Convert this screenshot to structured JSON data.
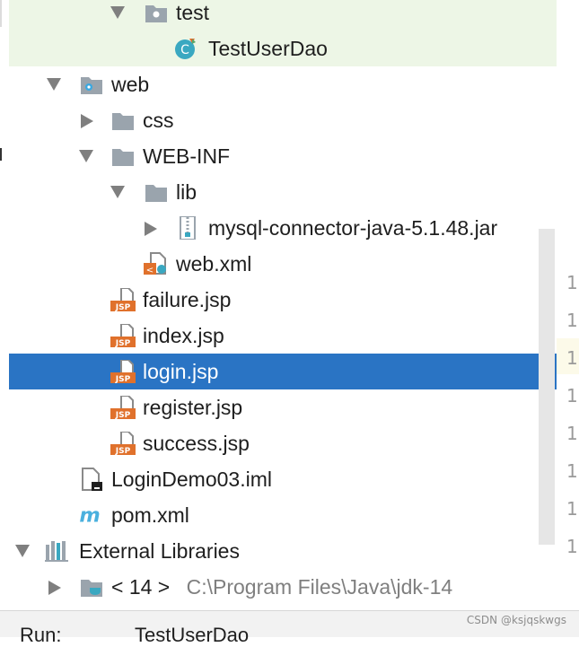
{
  "tree": {
    "items": [
      {
        "label": "test",
        "icon": "folder-icon",
        "state": "expanded"
      },
      {
        "label": "TestUserDao",
        "icon": "class-icon"
      },
      {
        "label": "web",
        "icon": "web-folder-icon",
        "state": "expanded"
      },
      {
        "label": "css",
        "icon": "folder-icon",
        "state": "collapsed"
      },
      {
        "label": "WEB-INF",
        "icon": "folder-icon",
        "state": "expanded"
      },
      {
        "label": "lib",
        "icon": "folder-icon",
        "state": "expanded"
      },
      {
        "label": "mysql-connector-java-5.1.48.jar",
        "icon": "jar-icon",
        "state": "collapsed"
      },
      {
        "label": "web.xml",
        "icon": "xml-icon"
      },
      {
        "label": "failure.jsp",
        "icon": "jsp-icon"
      },
      {
        "label": "index.jsp",
        "icon": "jsp-icon"
      },
      {
        "label": "login.jsp",
        "icon": "jsp-icon",
        "selected": true
      },
      {
        "label": "register.jsp",
        "icon": "jsp-icon"
      },
      {
        "label": "success.jsp",
        "icon": "jsp-icon"
      },
      {
        "label": "LoginDemo03.iml",
        "icon": "iml-icon"
      },
      {
        "label": "pom.xml",
        "icon": "maven-icon"
      },
      {
        "label": "External Libraries",
        "icon": "libraries-icon",
        "state": "expanded"
      },
      {
        "label": "< 14 >",
        "hint": "C:\\Program Files\\Java\\jdk-14",
        "icon": "jdk-icon",
        "state": "collapsed"
      }
    ]
  },
  "gutter": {
    "line_numbers": [
      "1",
      "1",
      "1",
      "1",
      "1",
      "1",
      "1",
      "1"
    ]
  },
  "bottom_bar": {
    "run_label": "Run:",
    "tab_label": "TestUserDao"
  },
  "watermark": "CSDN @ksjqskwgs",
  "colors": {
    "selection": "#2a74c4",
    "test_scope_background": "#edf6e6",
    "jsp_icon": "#e0712c",
    "class_icon": "#3aa8c1"
  }
}
